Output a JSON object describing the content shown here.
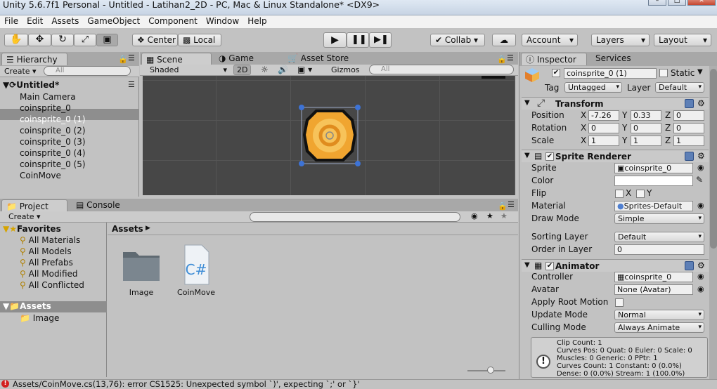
{
  "window": {
    "title": "Unity 5.6.7f1 Personal - Untitled - Latihan2_2D - PC, Mac & Linux Standalone* <DX9>"
  },
  "menu": [
    "File",
    "Edit",
    "Assets",
    "GameObject",
    "Component",
    "Window",
    "Help"
  ],
  "toolbar": {
    "center": "Center",
    "local": "Local",
    "collab": "Collab",
    "account": "Account",
    "layers": "Layers",
    "layout": "Layout"
  },
  "hierarchy": {
    "tab": "Hierarchy",
    "create": "Create",
    "search_placeholder": "All",
    "scene": "Untitled*",
    "items": [
      "Main Camera",
      "coinsprite_0",
      "coinsprite_0 (1)",
      "coinsprite_0 (2)",
      "coinsprite_0 (3)",
      "coinsprite_0 (4)",
      "coinsprite_0 (5)",
      "CoinMove"
    ],
    "selected_index": 2
  },
  "scene": {
    "tabs": [
      "Scene",
      "Game",
      "Asset Store"
    ],
    "shading": "Shaded",
    "mode2d": "2D",
    "gizmos": "Gizmos",
    "search_placeholder": "All"
  },
  "project": {
    "tabs": [
      "Project",
      "Console"
    ],
    "create": "Create",
    "favorites_label": "Favorites",
    "favorites": [
      "All Materials",
      "All Models",
      "All Prefabs",
      "All Modified",
      "All Conflicted"
    ],
    "assets_label": "Assets",
    "asset_folders": [
      "Image"
    ],
    "breadcrumb": "Assets",
    "files": [
      {
        "name": "Image",
        "icon": "folder-icon"
      },
      {
        "name": "CoinMove",
        "icon": "csharp-script-icon"
      }
    ]
  },
  "inspector": {
    "tabs": [
      "Inspector",
      "Services"
    ],
    "object_name": "coinsprite_0 (1)",
    "static_label": "Static",
    "tag_label": "Tag",
    "tag": "Untagged",
    "layer_label": "Layer",
    "layer": "Default",
    "transform": {
      "title": "Transform",
      "rows": [
        {
          "label": "Position",
          "x": "-7.26",
          "y": "0.33",
          "z": "0"
        },
        {
          "label": "Rotation",
          "x": "0",
          "y": "0",
          "z": "0"
        },
        {
          "label": "Scale",
          "x": "1",
          "y": "1",
          "z": "1"
        }
      ]
    },
    "sprite_renderer": {
      "title": "Sprite Renderer",
      "sprite_label": "Sprite",
      "sprite": "coinsprite_0",
      "color_label": "Color",
      "flip_label": "Flip",
      "flip_x": "X",
      "flip_y": "Y",
      "material_label": "Material",
      "material": "Sprites-Default",
      "draw_mode_label": "Draw Mode",
      "draw_mode": "Simple",
      "sorting_layer_label": "Sorting Layer",
      "sorting_layer": "Default",
      "order_label": "Order in Layer",
      "order": "0"
    },
    "animator": {
      "title": "Animator",
      "controller_label": "Controller",
      "controller": "coinsprite_0",
      "avatar_label": "Avatar",
      "avatar": "None (Avatar)",
      "root_motion_label": "Apply Root Motion",
      "update_mode_label": "Update Mode",
      "update_mode": "Normal",
      "culling_mode_label": "Culling Mode",
      "culling_mode": "Always Animate",
      "info": [
        "Clip Count: 1",
        "Curves Pos: 0 Quat: 0 Euler: 0 Scale: 0",
        "Muscles: 0 Generic: 0 PPtr: 1",
        "Curves Count: 1 Constant: 0 (0.0%)",
        "Dense: 0 (0.0%) Stream: 1 (100.0%)"
      ]
    }
  },
  "status": {
    "error": "Assets/CoinMove.cs(13,76): error CS1525: Unexpected symbol `)', expecting `;' or `}'"
  }
}
